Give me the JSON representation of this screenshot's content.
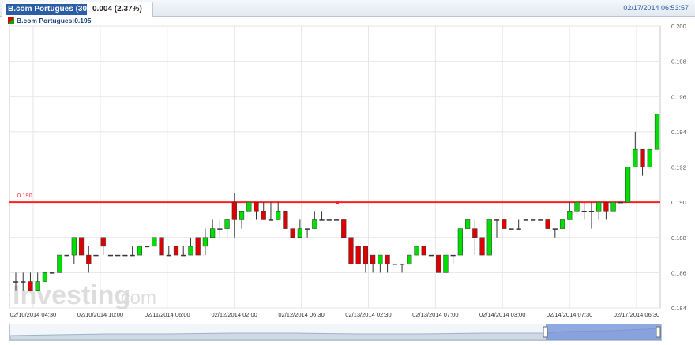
{
  "header": {
    "tab_title": "B.com Portugues (30 ...",
    "change": "0.004 (2.37%)",
    "timestamp": "02/17/2014 06:53:57",
    "legend": "B.com Portugues:0.195"
  },
  "watermark": {
    "brand": "Investing",
    "suffix": ".com"
  },
  "colors": {
    "up": "#00dd00",
    "down": "#dd0000",
    "level": "#ff2020",
    "grid": "#e6e6e6"
  },
  "chart_data": {
    "type": "candlestick",
    "title": "B.com Portugues:0.195",
    "ylim": [
      0.184,
      0.2
    ],
    "y_ticks": [
      "0.200",
      "0.198",
      "0.196",
      "0.194",
      "0.192",
      "0.190",
      "0.188",
      "0.186",
      "0.184"
    ],
    "x_tick_labels": [
      "02/10/2014 04:30",
      "02/10/2014 10:00",
      "02/11/2014 06:00",
      "02/12/2014 02:00",
      "02/12/2014 06:30",
      "02/13/2014 02:30",
      "02/13/2014 07:00",
      "02/14/2014 03:00",
      "02/14/2014 07:30",
      "02/17/2014 06:30"
    ],
    "horizontal_line": {
      "value": 0.19,
      "label": "0.190"
    },
    "candles": [
      {
        "o": 0.1855,
        "h": 0.186,
        "l": 0.185,
        "c": 0.1855
      },
      {
        "o": 0.1855,
        "h": 0.186,
        "l": 0.185,
        "c": 0.1855
      },
      {
        "o": 0.1855,
        "h": 0.186,
        "l": 0.185,
        "c": 0.185
      },
      {
        "o": 0.185,
        "h": 0.186,
        "l": 0.185,
        "c": 0.1855
      },
      {
        "o": 0.1855,
        "h": 0.186,
        "l": 0.1855,
        "c": 0.186
      },
      {
        "o": 0.186,
        "h": 0.186,
        "l": 0.186,
        "c": 0.186
      },
      {
        "o": 0.186,
        "h": 0.187,
        "l": 0.186,
        "c": 0.187
      },
      {
        "o": 0.187,
        "h": 0.187,
        "l": 0.187,
        "c": 0.187
      },
      {
        "o": 0.187,
        "h": 0.188,
        "l": 0.1865,
        "c": 0.188
      },
      {
        "o": 0.188,
        "h": 0.188,
        "l": 0.187,
        "c": 0.187
      },
      {
        "o": 0.187,
        "h": 0.1875,
        "l": 0.186,
        "c": 0.1865
      },
      {
        "o": 0.187,
        "h": 0.1875,
        "l": 0.186,
        "c": 0.187
      },
      {
        "o": 0.188,
        "h": 0.188,
        "l": 0.187,
        "c": 0.1875
      },
      {
        "o": 0.187,
        "h": 0.187,
        "l": 0.187,
        "c": 0.187
      },
      {
        "o": 0.187,
        "h": 0.187,
        "l": 0.187,
        "c": 0.187
      },
      {
        "o": 0.187,
        "h": 0.187,
        "l": 0.187,
        "c": 0.187
      },
      {
        "o": 0.187,
        "h": 0.1875,
        "l": 0.187,
        "c": 0.187
      },
      {
        "o": 0.187,
        "h": 0.1875,
        "l": 0.187,
        "c": 0.1875
      },
      {
        "o": 0.1875,
        "h": 0.1875,
        "l": 0.1875,
        "c": 0.1875
      },
      {
        "o": 0.1875,
        "h": 0.188,
        "l": 0.1875,
        "c": 0.188
      },
      {
        "o": 0.188,
        "h": 0.188,
        "l": 0.187,
        "c": 0.187
      },
      {
        "o": 0.187,
        "h": 0.1875,
        "l": 0.187,
        "c": 0.187
      },
      {
        "o": 0.1875,
        "h": 0.1875,
        "l": 0.187,
        "c": 0.187
      },
      {
        "o": 0.187,
        "h": 0.1875,
        "l": 0.187,
        "c": 0.187
      },
      {
        "o": 0.187,
        "h": 0.188,
        "l": 0.187,
        "c": 0.1875
      },
      {
        "o": 0.188,
        "h": 0.188,
        "l": 0.187,
        "c": 0.187
      },
      {
        "o": 0.1875,
        "h": 0.1885,
        "l": 0.187,
        "c": 0.188
      },
      {
        "o": 0.188,
        "h": 0.189,
        "l": 0.188,
        "c": 0.1885
      },
      {
        "o": 0.1885,
        "h": 0.189,
        "l": 0.188,
        "c": 0.1885
      },
      {
        "o": 0.1885,
        "h": 0.189,
        "l": 0.188,
        "c": 0.189
      },
      {
        "o": 0.19,
        "h": 0.1905,
        "l": 0.188,
        "c": 0.189
      },
      {
        "o": 0.189,
        "h": 0.1895,
        "l": 0.1885,
        "c": 0.1895
      },
      {
        "o": 0.1895,
        "h": 0.19,
        "l": 0.1895,
        "c": 0.19
      },
      {
        "o": 0.19,
        "h": 0.19,
        "l": 0.189,
        "c": 0.1895
      },
      {
        "o": 0.1895,
        "h": 0.19,
        "l": 0.189,
        "c": 0.189
      },
      {
        "o": 0.189,
        "h": 0.19,
        "l": 0.189,
        "c": 0.189
      },
      {
        "o": 0.189,
        "h": 0.19,
        "l": 0.189,
        "c": 0.1895
      },
      {
        "o": 0.1895,
        "h": 0.1895,
        "l": 0.1885,
        "c": 0.1885
      },
      {
        "o": 0.1885,
        "h": 0.1885,
        "l": 0.188,
        "c": 0.188
      },
      {
        "o": 0.188,
        "h": 0.189,
        "l": 0.188,
        "c": 0.1885
      },
      {
        "o": 0.1885,
        "h": 0.1885,
        "l": 0.188,
        "c": 0.1885
      },
      {
        "o": 0.1885,
        "h": 0.1895,
        "l": 0.1885,
        "c": 0.189
      },
      {
        "o": 0.189,
        "h": 0.1895,
        "l": 0.189,
        "c": 0.189
      },
      {
        "o": 0.189,
        "h": 0.189,
        "l": 0.189,
        "c": 0.189
      },
      {
        "o": 0.189,
        "h": 0.189,
        "l": 0.189,
        "c": 0.189
      },
      {
        "o": 0.189,
        "h": 0.189,
        "l": 0.188,
        "c": 0.188
      },
      {
        "o": 0.188,
        "h": 0.188,
        "l": 0.1865,
        "c": 0.1865
      },
      {
        "o": 0.1875,
        "h": 0.1875,
        "l": 0.1865,
        "c": 0.1865
      },
      {
        "o": 0.1875,
        "h": 0.1875,
        "l": 0.186,
        "c": 0.1865
      },
      {
        "o": 0.187,
        "h": 0.187,
        "l": 0.186,
        "c": 0.1865
      },
      {
        "o": 0.1865,
        "h": 0.187,
        "l": 0.186,
        "c": 0.187
      },
      {
        "o": 0.187,
        "h": 0.187,
        "l": 0.186,
        "c": 0.1865
      },
      {
        "o": 0.1865,
        "h": 0.1865,
        "l": 0.1865,
        "c": 0.1865
      },
      {
        "o": 0.1865,
        "h": 0.1865,
        "l": 0.186,
        "c": 0.1865
      },
      {
        "o": 0.1865,
        "h": 0.187,
        "l": 0.1865,
        "c": 0.187
      },
      {
        "o": 0.187,
        "h": 0.1875,
        "l": 0.187,
        "c": 0.1875
      },
      {
        "o": 0.1875,
        "h": 0.1875,
        "l": 0.187,
        "c": 0.187
      },
      {
        "o": 0.187,
        "h": 0.187,
        "l": 0.187,
        "c": 0.187
      },
      {
        "o": 0.187,
        "h": 0.187,
        "l": 0.186,
        "c": 0.186
      },
      {
        "o": 0.186,
        "h": 0.187,
        "l": 0.186,
        "c": 0.187
      },
      {
        "o": 0.187,
        "h": 0.187,
        "l": 0.1865,
        "c": 0.187
      },
      {
        "o": 0.187,
        "h": 0.1885,
        "l": 0.187,
        "c": 0.1885
      },
      {
        "o": 0.1885,
        "h": 0.189,
        "l": 0.1885,
        "c": 0.189
      },
      {
        "o": 0.1885,
        "h": 0.189,
        "l": 0.187,
        "c": 0.188
      },
      {
        "o": 0.188,
        "h": 0.188,
        "l": 0.187,
        "c": 0.187
      },
      {
        "o": 0.187,
        "h": 0.189,
        "l": 0.187,
        "c": 0.189
      },
      {
        "o": 0.189,
        "h": 0.189,
        "l": 0.188,
        "c": 0.189
      },
      {
        "o": 0.189,
        "h": 0.189,
        "l": 0.1885,
        "c": 0.1885
      },
      {
        "o": 0.1885,
        "h": 0.1885,
        "l": 0.1885,
        "c": 0.1885
      },
      {
        "o": 0.1885,
        "h": 0.189,
        "l": 0.1885,
        "c": 0.1885
      },
      {
        "o": 0.189,
        "h": 0.189,
        "l": 0.189,
        "c": 0.189
      },
      {
        "o": 0.189,
        "h": 0.189,
        "l": 0.189,
        "c": 0.189
      },
      {
        "o": 0.189,
        "h": 0.189,
        "l": 0.189,
        "c": 0.189
      },
      {
        "o": 0.189,
        "h": 0.189,
        "l": 0.1885,
        "c": 0.1885
      },
      {
        "o": 0.1885,
        "h": 0.1885,
        "l": 0.188,
        "c": 0.1885
      },
      {
        "o": 0.1885,
        "h": 0.189,
        "l": 0.1885,
        "c": 0.189
      },
      {
        "o": 0.189,
        "h": 0.19,
        "l": 0.189,
        "c": 0.1895
      },
      {
        "o": 0.1895,
        "h": 0.19,
        "l": 0.1895,
        "c": 0.19
      },
      {
        "o": 0.1895,
        "h": 0.19,
        "l": 0.189,
        "c": 0.1895
      },
      {
        "o": 0.1895,
        "h": 0.19,
        "l": 0.1885,
        "c": 0.1895
      },
      {
        "o": 0.1895,
        "h": 0.19,
        "l": 0.189,
        "c": 0.19
      },
      {
        "o": 0.19,
        "h": 0.19,
        "l": 0.189,
        "c": 0.1895
      },
      {
        "o": 0.1895,
        "h": 0.19,
        "l": 0.1895,
        "c": 0.19
      },
      {
        "o": 0.19,
        "h": 0.19,
        "l": 0.19,
        "c": 0.19
      },
      {
        "o": 0.19,
        "h": 0.192,
        "l": 0.19,
        "c": 0.192
      },
      {
        "o": 0.192,
        "h": 0.194,
        "l": 0.192,
        "c": 0.193
      },
      {
        "o": 0.193,
        "h": 0.193,
        "l": 0.1915,
        "c": 0.192
      },
      {
        "o": 0.192,
        "h": 0.193,
        "l": 0.192,
        "c": 0.193
      },
      {
        "o": 0.193,
        "h": 0.195,
        "l": 0.193,
        "c": 0.195
      }
    ]
  }
}
